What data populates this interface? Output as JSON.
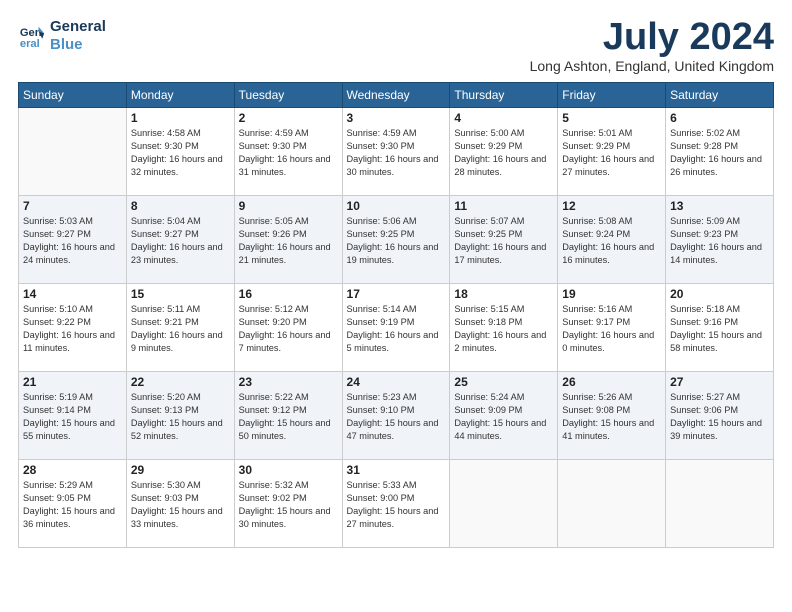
{
  "logo": {
    "line1": "General",
    "line2": "Blue"
  },
  "title": "July 2024",
  "location": "Long Ashton, England, United Kingdom",
  "weekdays": [
    "Sunday",
    "Monday",
    "Tuesday",
    "Wednesday",
    "Thursday",
    "Friday",
    "Saturday"
  ],
  "weeks": [
    [
      {
        "day": "",
        "sunrise": "",
        "sunset": "",
        "daylight": ""
      },
      {
        "day": "1",
        "sunrise": "Sunrise: 4:58 AM",
        "sunset": "Sunset: 9:30 PM",
        "daylight": "Daylight: 16 hours and 32 minutes."
      },
      {
        "day": "2",
        "sunrise": "Sunrise: 4:59 AM",
        "sunset": "Sunset: 9:30 PM",
        "daylight": "Daylight: 16 hours and 31 minutes."
      },
      {
        "day": "3",
        "sunrise": "Sunrise: 4:59 AM",
        "sunset": "Sunset: 9:30 PM",
        "daylight": "Daylight: 16 hours and 30 minutes."
      },
      {
        "day": "4",
        "sunrise": "Sunrise: 5:00 AM",
        "sunset": "Sunset: 9:29 PM",
        "daylight": "Daylight: 16 hours and 28 minutes."
      },
      {
        "day": "5",
        "sunrise": "Sunrise: 5:01 AM",
        "sunset": "Sunset: 9:29 PM",
        "daylight": "Daylight: 16 hours and 27 minutes."
      },
      {
        "day": "6",
        "sunrise": "Sunrise: 5:02 AM",
        "sunset": "Sunset: 9:28 PM",
        "daylight": "Daylight: 16 hours and 26 minutes."
      }
    ],
    [
      {
        "day": "7",
        "sunrise": "Sunrise: 5:03 AM",
        "sunset": "Sunset: 9:27 PM",
        "daylight": "Daylight: 16 hours and 24 minutes."
      },
      {
        "day": "8",
        "sunrise": "Sunrise: 5:04 AM",
        "sunset": "Sunset: 9:27 PM",
        "daylight": "Daylight: 16 hours and 23 minutes."
      },
      {
        "day": "9",
        "sunrise": "Sunrise: 5:05 AM",
        "sunset": "Sunset: 9:26 PM",
        "daylight": "Daylight: 16 hours and 21 minutes."
      },
      {
        "day": "10",
        "sunrise": "Sunrise: 5:06 AM",
        "sunset": "Sunset: 9:25 PM",
        "daylight": "Daylight: 16 hours and 19 minutes."
      },
      {
        "day": "11",
        "sunrise": "Sunrise: 5:07 AM",
        "sunset": "Sunset: 9:25 PM",
        "daylight": "Daylight: 16 hours and 17 minutes."
      },
      {
        "day": "12",
        "sunrise": "Sunrise: 5:08 AM",
        "sunset": "Sunset: 9:24 PM",
        "daylight": "Daylight: 16 hours and 16 minutes."
      },
      {
        "day": "13",
        "sunrise": "Sunrise: 5:09 AM",
        "sunset": "Sunset: 9:23 PM",
        "daylight": "Daylight: 16 hours and 14 minutes."
      }
    ],
    [
      {
        "day": "14",
        "sunrise": "Sunrise: 5:10 AM",
        "sunset": "Sunset: 9:22 PM",
        "daylight": "Daylight: 16 hours and 11 minutes."
      },
      {
        "day": "15",
        "sunrise": "Sunrise: 5:11 AM",
        "sunset": "Sunset: 9:21 PM",
        "daylight": "Daylight: 16 hours and 9 minutes."
      },
      {
        "day": "16",
        "sunrise": "Sunrise: 5:12 AM",
        "sunset": "Sunset: 9:20 PM",
        "daylight": "Daylight: 16 hours and 7 minutes."
      },
      {
        "day": "17",
        "sunrise": "Sunrise: 5:14 AM",
        "sunset": "Sunset: 9:19 PM",
        "daylight": "Daylight: 16 hours and 5 minutes."
      },
      {
        "day": "18",
        "sunrise": "Sunrise: 5:15 AM",
        "sunset": "Sunset: 9:18 PM",
        "daylight": "Daylight: 16 hours and 2 minutes."
      },
      {
        "day": "19",
        "sunrise": "Sunrise: 5:16 AM",
        "sunset": "Sunset: 9:17 PM",
        "daylight": "Daylight: 16 hours and 0 minutes."
      },
      {
        "day": "20",
        "sunrise": "Sunrise: 5:18 AM",
        "sunset": "Sunset: 9:16 PM",
        "daylight": "Daylight: 15 hours and 58 minutes."
      }
    ],
    [
      {
        "day": "21",
        "sunrise": "Sunrise: 5:19 AM",
        "sunset": "Sunset: 9:14 PM",
        "daylight": "Daylight: 15 hours and 55 minutes."
      },
      {
        "day": "22",
        "sunrise": "Sunrise: 5:20 AM",
        "sunset": "Sunset: 9:13 PM",
        "daylight": "Daylight: 15 hours and 52 minutes."
      },
      {
        "day": "23",
        "sunrise": "Sunrise: 5:22 AM",
        "sunset": "Sunset: 9:12 PM",
        "daylight": "Daylight: 15 hours and 50 minutes."
      },
      {
        "day": "24",
        "sunrise": "Sunrise: 5:23 AM",
        "sunset": "Sunset: 9:10 PM",
        "daylight": "Daylight: 15 hours and 47 minutes."
      },
      {
        "day": "25",
        "sunrise": "Sunrise: 5:24 AM",
        "sunset": "Sunset: 9:09 PM",
        "daylight": "Daylight: 15 hours and 44 minutes."
      },
      {
        "day": "26",
        "sunrise": "Sunrise: 5:26 AM",
        "sunset": "Sunset: 9:08 PM",
        "daylight": "Daylight: 15 hours and 41 minutes."
      },
      {
        "day": "27",
        "sunrise": "Sunrise: 5:27 AM",
        "sunset": "Sunset: 9:06 PM",
        "daylight": "Daylight: 15 hours and 39 minutes."
      }
    ],
    [
      {
        "day": "28",
        "sunrise": "Sunrise: 5:29 AM",
        "sunset": "Sunset: 9:05 PM",
        "daylight": "Daylight: 15 hours and 36 minutes."
      },
      {
        "day": "29",
        "sunrise": "Sunrise: 5:30 AM",
        "sunset": "Sunset: 9:03 PM",
        "daylight": "Daylight: 15 hours and 33 minutes."
      },
      {
        "day": "30",
        "sunrise": "Sunrise: 5:32 AM",
        "sunset": "Sunset: 9:02 PM",
        "daylight": "Daylight: 15 hours and 30 minutes."
      },
      {
        "day": "31",
        "sunrise": "Sunrise: 5:33 AM",
        "sunset": "Sunset: 9:00 PM",
        "daylight": "Daylight: 15 hours and 27 minutes."
      },
      {
        "day": "",
        "sunrise": "",
        "sunset": "",
        "daylight": ""
      },
      {
        "day": "",
        "sunrise": "",
        "sunset": "",
        "daylight": ""
      },
      {
        "day": "",
        "sunrise": "",
        "sunset": "",
        "daylight": ""
      }
    ]
  ]
}
